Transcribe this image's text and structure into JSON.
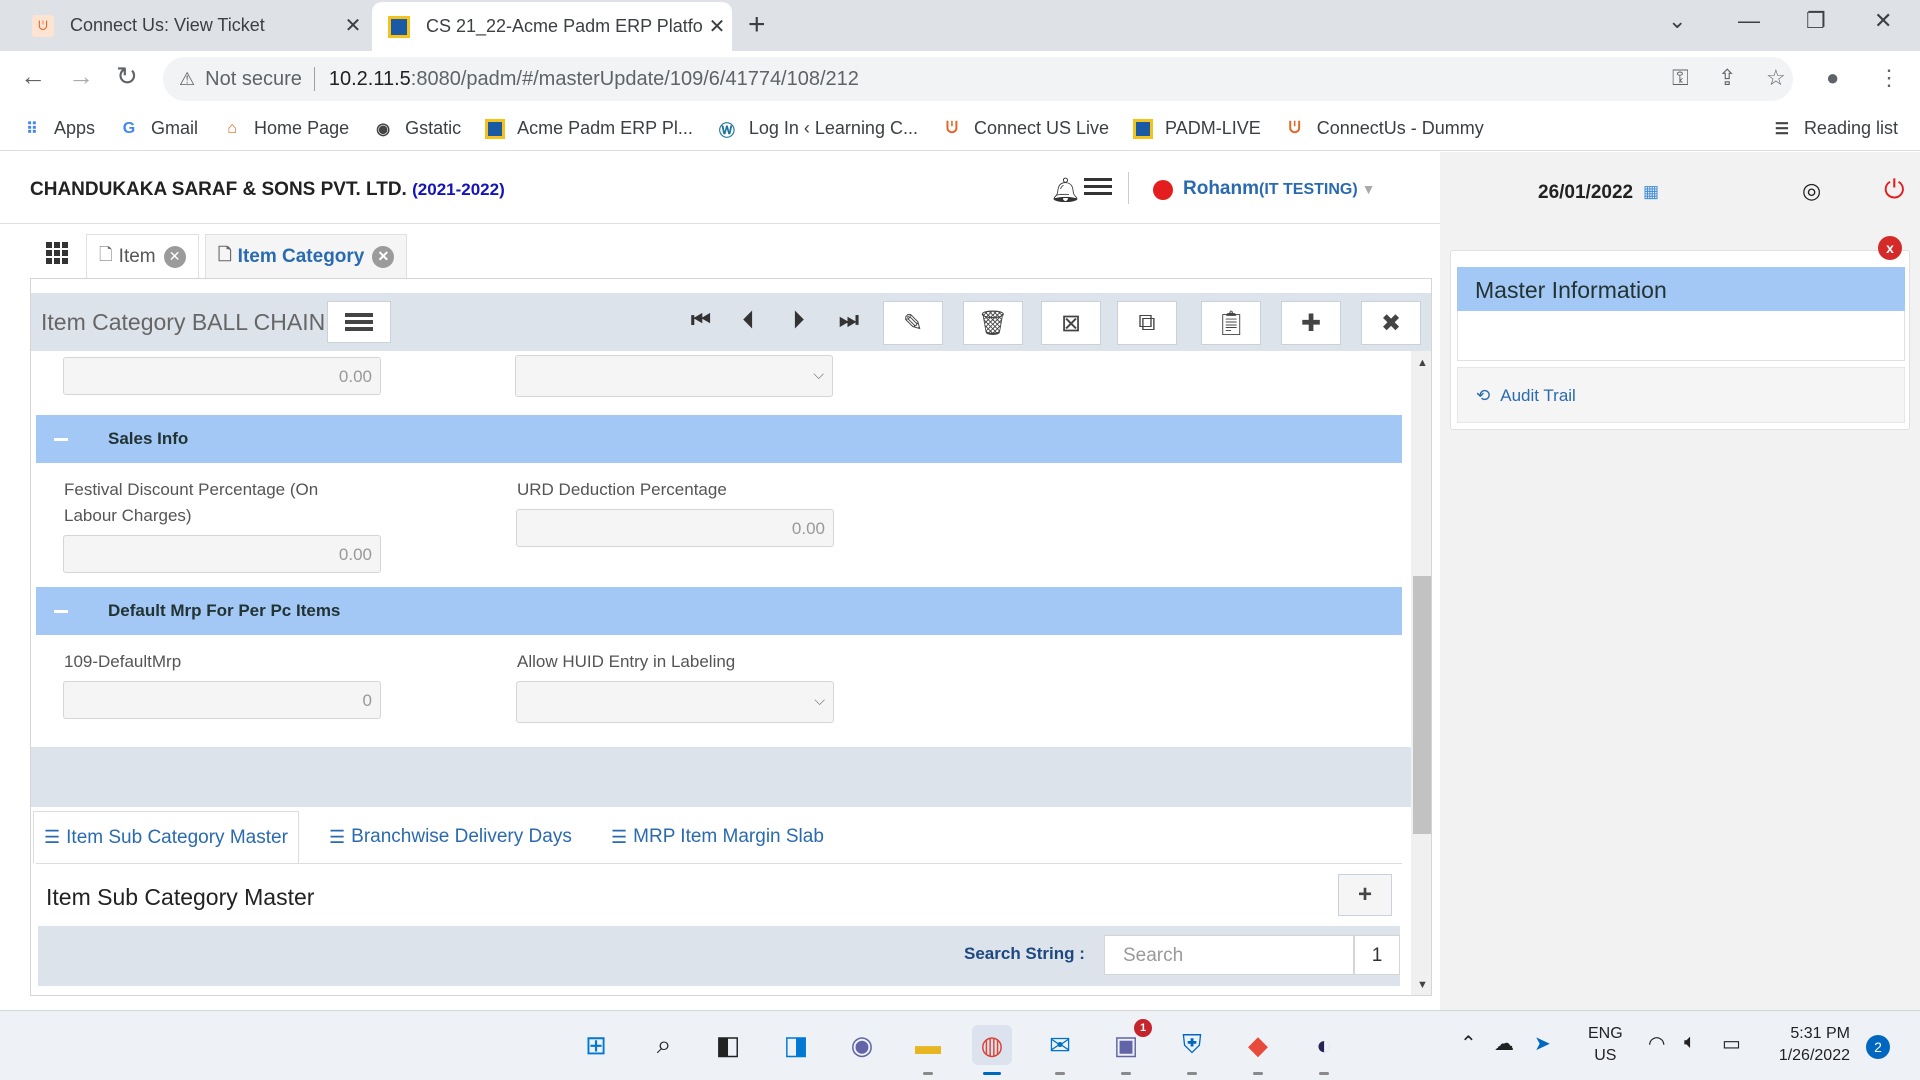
{
  "browser": {
    "tabs": [
      {
        "title": "Connect Us: View Ticket",
        "active": false
      },
      {
        "title": "CS 21_22-Acme Padm ERP Platfo",
        "active": true
      }
    ],
    "address": {
      "security": "Not secure",
      "host": "10.2.11.5",
      "path": ":8080/padm/#/masterUpdate/109/6/41774/108/212"
    },
    "bookmarks": [
      {
        "label": "Apps",
        "icon": "apps-grid-icon"
      },
      {
        "label": "Gmail",
        "icon": "google-icon"
      },
      {
        "label": "Home Page",
        "icon": "homepage-icon"
      },
      {
        "label": "Gstatic",
        "icon": "globe-icon"
      },
      {
        "label": "Acme Padm ERP Pl...",
        "icon": "padm-icon"
      },
      {
        "label": "Log In ‹ Learning C...",
        "icon": "wordpress-icon"
      },
      {
        "label": "Connect US Live",
        "icon": "connectus-icon"
      },
      {
        "label": "PADM-LIVE",
        "icon": "padm-icon"
      },
      {
        "label": "ConnectUs - Dummy",
        "icon": "connectus-icon"
      }
    ],
    "reading_list": "Reading list"
  },
  "header": {
    "company": "CHANDUKAKA SARAF & SONS PVT. LTD.",
    "year": "(2021-2022)",
    "user_name": "Rohanm",
    "user_role": "(IT TESTING)",
    "date": "26/01/2022"
  },
  "page_tabs": [
    {
      "label": "Item",
      "active": false
    },
    {
      "label": "Item Category",
      "active": true
    }
  ],
  "form": {
    "title": "Item Category BALL CHAIN",
    "top_field_value": "0.00",
    "sections": [
      {
        "title": "Sales Info",
        "fields": [
          {
            "label": "Festival Discount Percentage (On Labour Charges)",
            "value": "0.00"
          },
          {
            "label": "URD Deduction Percentage",
            "value": "0.00"
          }
        ]
      },
      {
        "title": "Default Mrp For Per Pc Items",
        "fields": [
          {
            "label": "109-DefaultMrp",
            "value": "0"
          },
          {
            "label": "Allow HUID Entry in Labeling",
            "value": ""
          }
        ]
      }
    ]
  },
  "sub_tabs": [
    {
      "label": "Item Sub Category Master",
      "active": true
    },
    {
      "label": "Branchwise Delivery Days",
      "active": false
    },
    {
      "label": "MRP Item Margin Slab",
      "active": false
    }
  ],
  "sub_panel": {
    "title": "Item Sub Category Master",
    "search_label": "Search String :",
    "search_placeholder": "Search",
    "count": "1"
  },
  "master_info": {
    "title": "Master Information",
    "audit_trail": "Audit Trail",
    "close": "x"
  },
  "taskbar": {
    "lang_line1": "ENG",
    "lang_line2": "US",
    "time": "5:31 PM",
    "date": "1/26/2022",
    "notifications": "2",
    "teams_badge": "1"
  },
  "colors": {
    "section_header": "#a4c8f5",
    "toolbar_bg": "#dde3ea",
    "link_blue": "#2a6ab0",
    "status_red": "#e41e1e"
  }
}
